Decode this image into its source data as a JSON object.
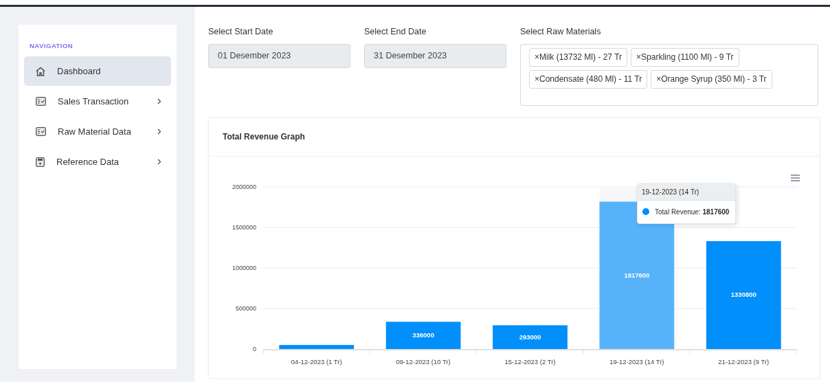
{
  "sidebar": {
    "heading": "NAVIGATION",
    "items": [
      {
        "label": "Dashboard",
        "kind": "home",
        "selected": true,
        "has_submenu": false
      },
      {
        "label": "Sales Transaction",
        "kind": "checklist",
        "selected": false,
        "has_submenu": true
      },
      {
        "label": "Raw Material Data",
        "kind": "checklist",
        "selected": false,
        "has_submenu": true
      },
      {
        "label": "Reference Data",
        "kind": "disk",
        "selected": false,
        "has_submenu": true
      }
    ]
  },
  "filters": {
    "start_date": {
      "label": "Select Start Date",
      "value": "01 Desember 2023"
    },
    "end_date": {
      "label": "Select End Date",
      "value": "31 Desember 2023"
    },
    "raw_materials": {
      "label": "Select Raw Materials",
      "remove_glyph": "×",
      "tags": [
        "Milk (13732 Ml) - 27 Tr",
        "Sparkling (1100 Ml) - 9 Tr",
        "Condensate (480 Ml) - 11 Tr",
        "Orange Syrup (350 Ml) - 3 Tr"
      ]
    }
  },
  "revenue_card": {
    "title": "Total Revenue Graph",
    "chart_data": {
      "type": "bar",
      "categories": [
        "04-12-2023 (1 Tr)",
        "09-12-2023 (10 Tr)",
        "15-12-2023 (2 Tr)",
        "19-12-2023 (14 Tr)",
        "21-12-2023 (9 Tr)"
      ],
      "series": [
        {
          "name": "Total Revenue",
          "color": "#008ffb",
          "values": [
            50000,
            336000,
            293000,
            1817600,
            1330800
          ]
        }
      ],
      "ylim": [
        0,
        2000000
      ],
      "yticks": [
        0,
        500000,
        1000000,
        1500000,
        2000000
      ],
      "grid": true,
      "value_labels": [
        null,
        "336000",
        "293000",
        "1817600",
        "1330800"
      ]
    },
    "bars": [
      {
        "hovered": false
      },
      {
        "hovered": false
      },
      {
        "hovered": false
      },
      {
        "hovered": true
      },
      {
        "hovered": false
      }
    ],
    "tooltip": {
      "title": "19-12-2023 (14 Tr)",
      "label_suffix": ":",
      "value": "1817600"
    }
  }
}
